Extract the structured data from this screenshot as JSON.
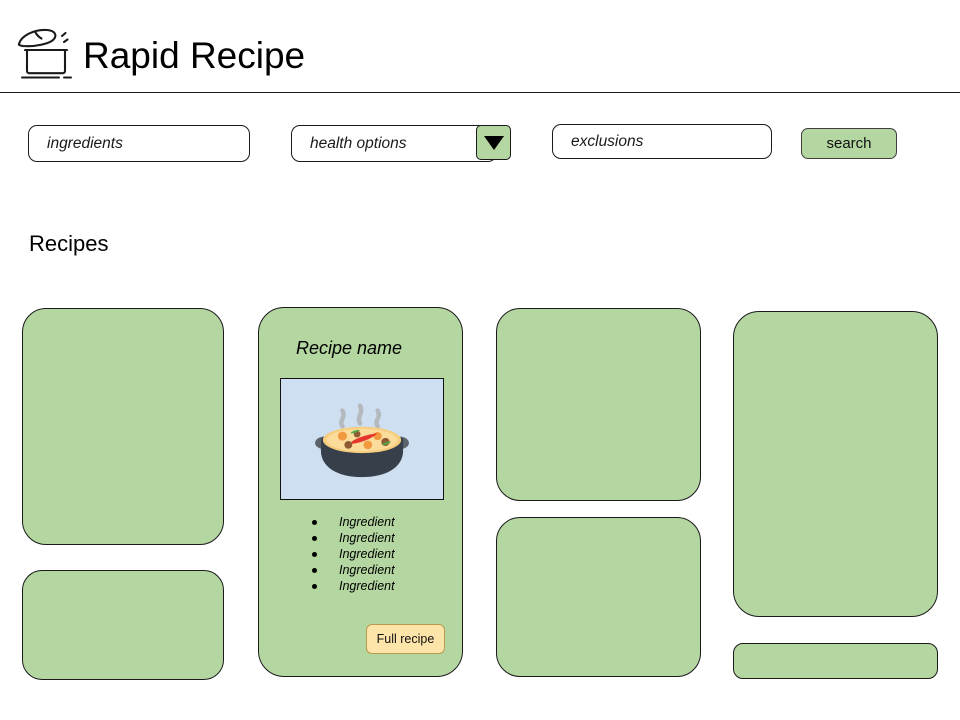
{
  "header": {
    "title": "Rapid Recipe",
    "logo_icon": "cooking-pot-icon"
  },
  "search_bar": {
    "ingredients": {
      "placeholder": "ingredients",
      "value": ""
    },
    "health_options": {
      "placeholder": "health options",
      "value": "",
      "dropdown_icon": "triangle-down-icon"
    },
    "exclusions": {
      "placeholder": "exclusions",
      "value": ""
    },
    "search_label": "search"
  },
  "main": {
    "section_heading": "Recipes"
  },
  "recipe_card": {
    "name": "Recipe name",
    "image_icon": "pot-of-food-icon",
    "ingredients": [
      "Ingredient",
      "Ingredient",
      "Ingredient",
      "Ingredient",
      "Ingredient"
    ],
    "full_recipe_label": "Full recipe"
  },
  "colors": {
    "card_green": "#b4d6a1",
    "card_border": "#1a1a1a",
    "image_background": "#cfdff2",
    "full_recipe_yellow": "#fde4a8",
    "full_recipe_border": "#b99a4e",
    "page_background": "#ffffff"
  }
}
